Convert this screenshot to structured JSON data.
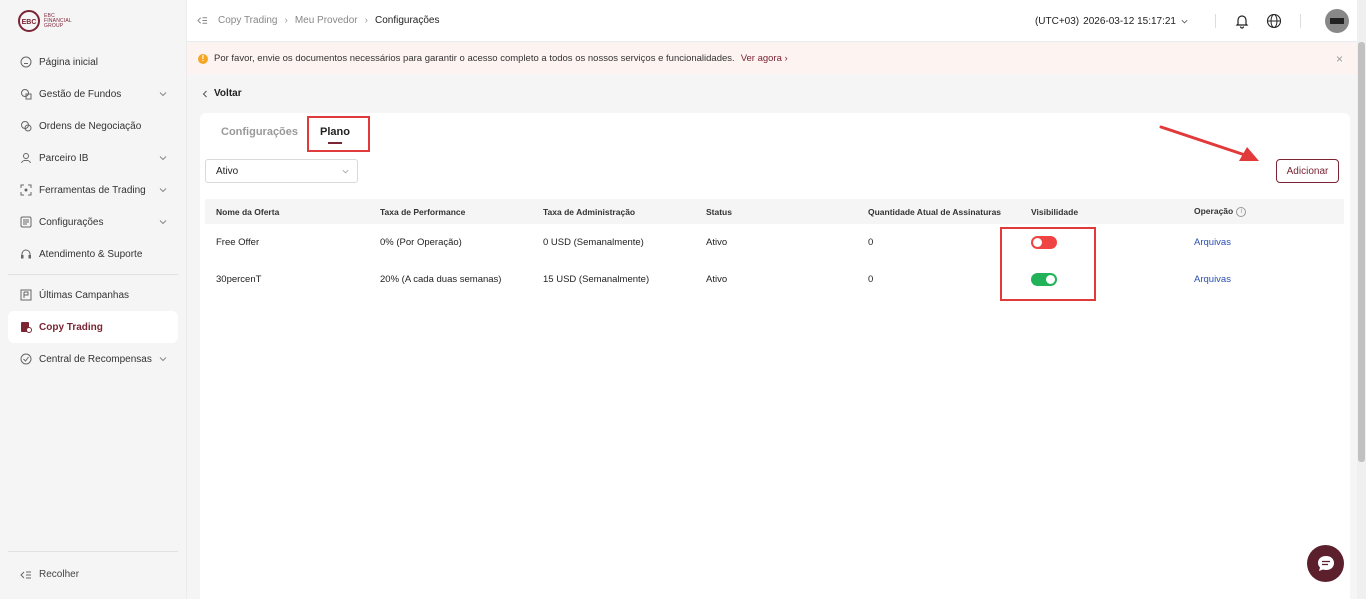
{
  "brand": {
    "logo_letters": "EBC",
    "logo_text_lines": [
      "EBC",
      "FINANCIAL",
      "GROUP"
    ]
  },
  "sidebar": {
    "items": [
      {
        "label": "Página inicial",
        "icon": "home-icon",
        "chevron": false
      },
      {
        "label": "Gestão de Fundos",
        "icon": "wallet-icon",
        "chevron": true
      },
      {
        "label": "Ordens de Negociação",
        "icon": "orders-icon",
        "chevron": false
      },
      {
        "label": "Parceiro IB",
        "icon": "partner-icon",
        "chevron": true
      },
      {
        "label": "Ferramentas de Trading",
        "icon": "tools-icon",
        "chevron": true
      },
      {
        "label": "Configurações",
        "icon": "settings-icon",
        "chevron": true
      },
      {
        "label": "Atendimento & Suporte",
        "icon": "headset-icon",
        "chevron": false
      },
      {
        "label": "Últimas Campanhas",
        "icon": "flag-icon",
        "chevron": false
      },
      {
        "label": "Copy Trading",
        "icon": "copy-trading-icon",
        "chevron": false,
        "active": true
      },
      {
        "label": "Central de Recompensas",
        "icon": "rewards-icon",
        "chevron": true
      }
    ],
    "collapse_label": "Recolher"
  },
  "header": {
    "breadcrumb": [
      "Copy Trading",
      "Meu Provedor",
      "Configurações"
    ],
    "timezone": "(UTC+03)",
    "datetime": "2026-03-12 15:17:21"
  },
  "notice": {
    "icon": "!",
    "text": "Por favor, envie os documentos necessários para garantir o acesso completo a todos os nossos serviços e funcionalidades.",
    "link": "Ver agora",
    "close": "×"
  },
  "back_label": "Voltar",
  "tabs": [
    "Configurações",
    "Plano"
  ],
  "filter": {
    "selected": "Ativo"
  },
  "add_button": "Adicionar",
  "table": {
    "headers": [
      "Nome da Oferta",
      "Taxa de Performance",
      "Taxa de Administração",
      "Status",
      "Quantidade Atual de Assinaturas",
      "Visibilidade",
      "Operação"
    ],
    "info_icon": "i",
    "rows": [
      {
        "name": "Free Offer",
        "performance": "0% (Por Operação)",
        "admin": "0 USD (Semanalmente)",
        "status": "Ativo",
        "subscriptions": "0",
        "visible": false,
        "operation": "Arquivas"
      },
      {
        "name": "30percenT",
        "performance": "20% (A cada duas semanas)",
        "admin": "15 USD (Semanalmente)",
        "status": "Ativo",
        "subscriptions": "0",
        "visible": true,
        "operation": "Arquivas"
      }
    ]
  },
  "colors": {
    "brand": "#7a2434",
    "toggle_on": "#22b35a",
    "toggle_off": "#f04444",
    "highlight": "#e03a3a",
    "link": "#2b4fb0"
  }
}
